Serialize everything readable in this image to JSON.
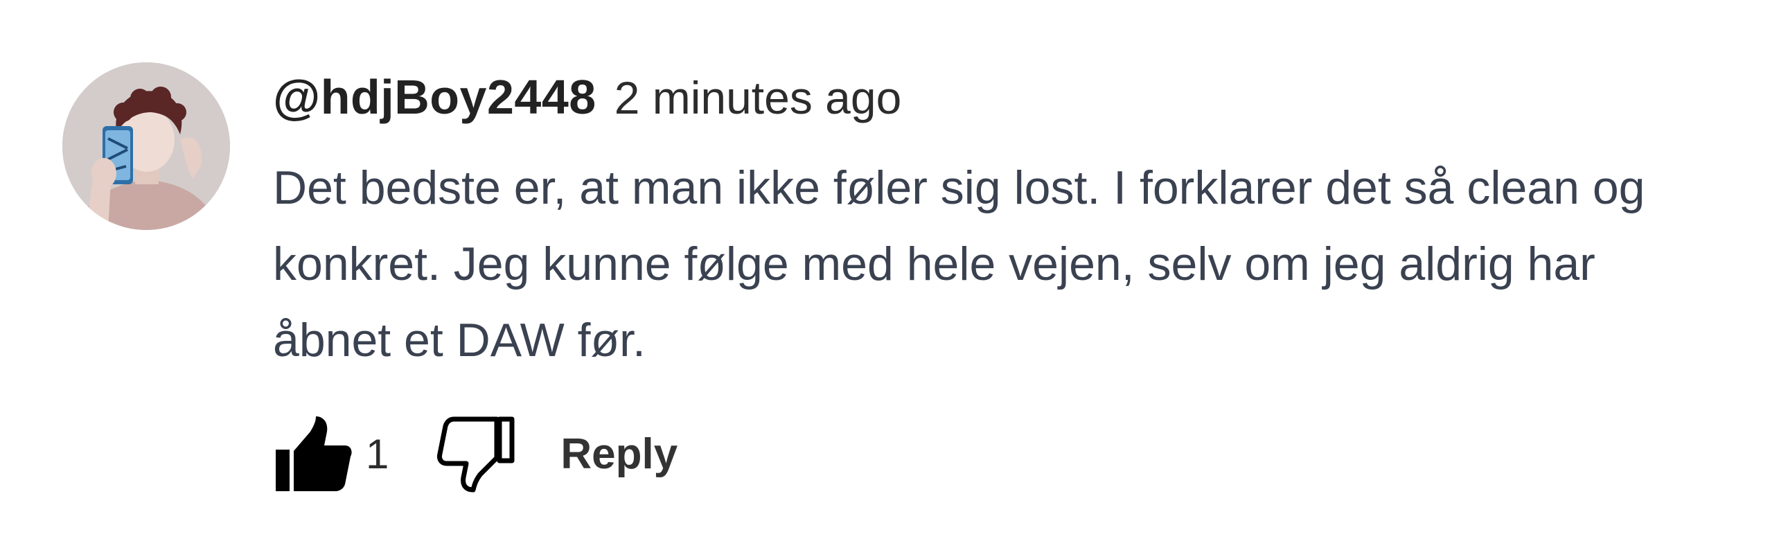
{
  "comment": {
    "author": "@hdjBoy2448",
    "timestamp": "2 minutes ago",
    "text": "Det bedste er, at man ikke føler sig lost. I forklarer det så clean og konkret. Jeg kunne følge med hele vejen, selv om jeg aldrig har åbnet et DAW før.",
    "like_count": "1",
    "reply_label": "Reply"
  },
  "icons": {
    "like": "thumbs-up-icon",
    "dislike": "thumbs-down-icon"
  },
  "colors": {
    "author": "#222222",
    "text": "#3a4150",
    "icon": "#000000"
  }
}
